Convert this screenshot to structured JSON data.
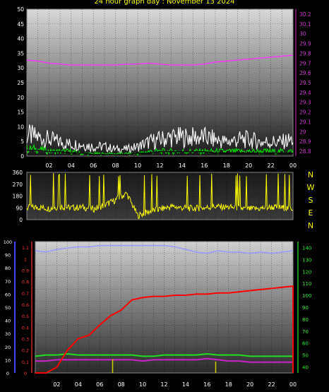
{
  "title": "24 hour graph day : November 13 2024",
  "chart_data": [
    {
      "type": "line",
      "x_ticks": [
        "02",
        "04",
        "06",
        "08",
        "10",
        "12",
        "14",
        "16",
        "18",
        "20",
        "22",
        "00"
      ],
      "left_axis": {
        "ticks": [
          "0",
          "5",
          "10",
          "15",
          "20",
          "25",
          "30",
          "35",
          "40",
          "45",
          "50"
        ],
        "ylim": [
          0,
          50
        ]
      },
      "right_axis": {
        "ticks": [
          "28.8",
          "28.9",
          "29",
          "29.1",
          "29.2",
          "29.3",
          "29.4",
          "29.5",
          "29.6",
          "29.7",
          "29.8",
          "29.9",
          "30",
          "30.1",
          "30.2"
        ],
        "ylim": [
          28.75,
          30.25
        ]
      },
      "series": [
        {
          "axis": "right",
          "color": "#ff33ff",
          "x": [
            0,
            1,
            2,
            3,
            4,
            5,
            6,
            7,
            8,
            9,
            10,
            11,
            12,
            13,
            14,
            15,
            16,
            17,
            18,
            19,
            20,
            21,
            22,
            23,
            24
          ],
          "y": [
            29.73,
            29.72,
            29.7,
            29.69,
            29.68,
            29.68,
            29.68,
            29.68,
            29.68,
            29.69,
            29.69,
            29.7,
            29.69,
            29.68,
            29.68,
            29.68,
            29.69,
            29.71,
            29.72,
            29.73,
            29.74,
            29.75,
            29.76,
            29.77,
            29.78
          ]
        },
        {
          "axis": "left",
          "color": "#ffffff",
          "style": "gust",
          "x": [
            0,
            1,
            2,
            3,
            4,
            5,
            6,
            7,
            8,
            9,
            10,
            11,
            12,
            13,
            14,
            15,
            16,
            17,
            18,
            19,
            20,
            21,
            22,
            23,
            24
          ],
          "y": [
            9,
            8,
            7,
            6,
            5,
            5,
            4,
            4,
            3,
            3,
            4,
            6,
            7,
            8,
            8,
            8,
            8,
            7,
            6,
            7,
            7,
            6,
            6,
            6,
            7
          ]
        },
        {
          "axis": "left",
          "color": "#00ee00",
          "x": [
            0,
            1,
            2,
            3,
            4,
            5,
            6,
            7,
            8,
            9,
            10,
            11,
            12,
            13,
            14,
            15,
            16,
            17,
            18,
            19,
            20,
            21,
            22,
            23,
            24
          ],
          "y": [
            3,
            3,
            2,
            2,
            2,
            1,
            1,
            1,
            1,
            1,
            1,
            2,
            2,
            2,
            2,
            2,
            2,
            2,
            2,
            2,
            2,
            2,
            2,
            2,
            2
          ]
        },
        {
          "axis": "left",
          "color": "#000000",
          "x": [
            0,
            1,
            2,
            3,
            4,
            5,
            6,
            7,
            8,
            9,
            10,
            11,
            12,
            13,
            14,
            15,
            16,
            17,
            18,
            19,
            20,
            21,
            22,
            23,
            24
          ],
          "y": [
            2,
            2,
            1.5,
            1.5,
            1,
            1,
            0.5,
            0.5,
            0.5,
            0.5,
            1,
            1,
            1.5,
            1.5,
            1.5,
            1.5,
            1.5,
            1,
            1,
            1,
            1,
            1,
            1,
            1,
            1
          ]
        }
      ]
    },
    {
      "type": "line",
      "x_ticks": [],
      "left_axis": {
        "ticks": [
          "0",
          "90",
          "180",
          "270",
          "360"
        ],
        "ylim": [
          0,
          360
        ]
      },
      "compass": [
        "N",
        "W",
        "S",
        "E",
        "N"
      ],
      "series": [
        {
          "color": "#ffff00",
          "style": "wind-direction",
          "x": [
            0,
            1,
            2,
            3,
            4,
            5,
            6,
            7,
            8,
            9,
            10,
            11,
            12,
            13,
            14,
            15,
            16,
            17,
            18,
            19,
            20,
            21,
            22,
            23,
            24
          ],
          "y": [
            90,
            95,
            85,
            100,
            90,
            95,
            80,
            110,
            150,
            200,
            30,
            60,
            80,
            100,
            90,
            85,
            90,
            100,
            95,
            90,
            80,
            85,
            95,
            90,
            85
          ]
        }
      ]
    },
    {
      "type": "line",
      "x_ticks": [
        "02",
        "04",
        "06",
        "08",
        "10",
        "12",
        "14",
        "16",
        "18",
        "20",
        "22",
        "00"
      ],
      "left_axis_humidity": {
        "color": "#4444ff",
        "ticks": [
          "0",
          "10",
          "20",
          "30",
          "40",
          "50",
          "60",
          "70",
          "80",
          "90",
          "100"
        ],
        "ylim": [
          0,
          100
        ]
      },
      "left_axis_rain": {
        "color": "#ff3333",
        "ticks": [
          "0",
          "0.1",
          "0.2",
          "0.3",
          "0.4",
          "0.5",
          "0.6",
          "0.7",
          "0.8",
          "0.9",
          "1",
          "1.1"
        ],
        "ylim": [
          0,
          1.15
        ]
      },
      "right_axis_temp": {
        "color": "#22ee22",
        "ticks": [
          "40",
          "50",
          "60",
          "70",
          "80",
          "90",
          "100",
          "110",
          "120",
          "130",
          "140"
        ],
        "ylim": [
          35,
          145
        ]
      },
      "series": [
        {
          "axis": "humidity",
          "color": "#9999ff",
          "x": [
            0,
            1,
            2,
            3,
            4,
            5,
            6,
            7,
            8,
            9,
            10,
            11,
            12,
            13,
            14,
            15,
            16,
            17,
            18,
            19,
            20,
            21,
            22,
            23,
            24
          ],
          "y": [
            93,
            92,
            94,
            95,
            96,
            96,
            97,
            97,
            97,
            97,
            97,
            97,
            97,
            96,
            94,
            92,
            91,
            93,
            92,
            92,
            91,
            92,
            91,
            92,
            93
          ]
        },
        {
          "axis": "rain",
          "color": "#ff0000",
          "x": [
            0,
            1,
            2,
            3,
            4,
            5,
            6,
            7,
            8,
            9,
            10,
            11,
            12,
            13,
            14,
            15,
            16,
            17,
            18,
            19,
            20,
            21,
            22,
            23,
            24
          ],
          "y": [
            0,
            0,
            0.05,
            0.2,
            0.3,
            0.33,
            0.42,
            0.5,
            0.55,
            0.64,
            0.66,
            0.67,
            0.67,
            0.68,
            0.68,
            0.69,
            0.69,
            0.7,
            0.7,
            0.71,
            0.72,
            0.73,
            0.74,
            0.75,
            0.76
          ]
        },
        {
          "axis": "temp",
          "color": "#22dd22",
          "x": [
            0,
            1,
            2,
            3,
            4,
            5,
            6,
            7,
            8,
            9,
            10,
            11,
            12,
            13,
            14,
            15,
            16,
            17,
            18,
            19,
            20,
            21,
            22,
            23,
            24
          ],
          "y": [
            49,
            50,
            50,
            51,
            50,
            50,
            50,
            50,
            50,
            50,
            49,
            49,
            50,
            50,
            50,
            50,
            51,
            50,
            50,
            50,
            49,
            49,
            49,
            49,
            49
          ]
        },
        {
          "axis": "temp",
          "color": "#cc22cc",
          "x": [
            0,
            1,
            2,
            3,
            4,
            5,
            6,
            7,
            8,
            9,
            10,
            11,
            12,
            13,
            14,
            15,
            16,
            17,
            18,
            19,
            20,
            21,
            22,
            23,
            24
          ],
          "y": [
            45,
            45,
            46,
            46,
            46,
            46,
            46,
            46,
            46,
            46,
            45,
            46,
            46,
            46,
            46,
            46,
            47,
            46,
            45,
            45,
            44,
            44,
            44,
            44,
            44
          ]
        },
        {
          "axis": "rain",
          "color": "#cccc00",
          "style": "spikes",
          "x": [
            7.2,
            16.8
          ],
          "y": [
            0.12,
            0.1
          ]
        }
      ]
    }
  ]
}
